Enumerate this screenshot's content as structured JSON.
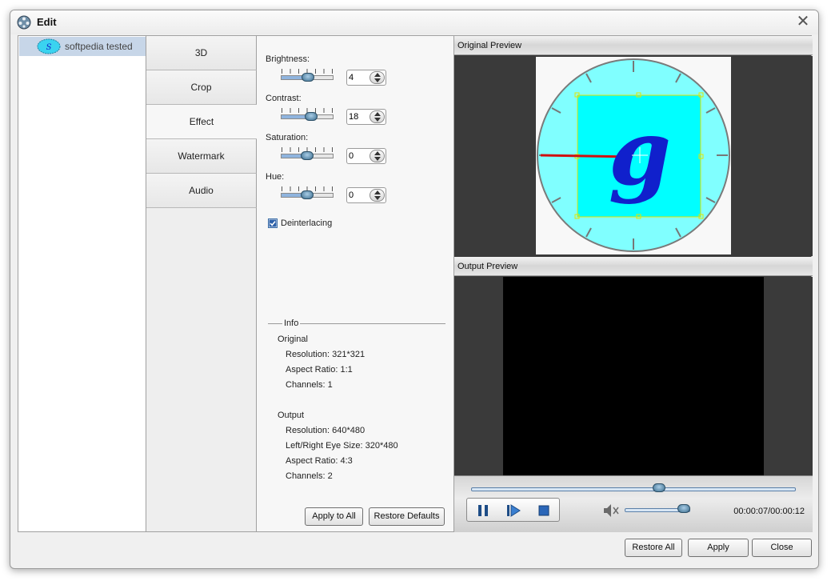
{
  "window": {
    "title": "Edit",
    "close_glyph": "✕"
  },
  "files": [
    {
      "label": "softpedia tested",
      "thumb_letter": "S"
    }
  ],
  "tabs": [
    {
      "label": "3D"
    },
    {
      "label": "Crop"
    },
    {
      "label": "Effect",
      "active": true
    },
    {
      "label": "Watermark"
    },
    {
      "label": "Audio"
    }
  ],
  "effect": {
    "brightness": {
      "label": "Brightness:",
      "value": "4",
      "fraction": 0.51
    },
    "contrast": {
      "label": "Contrast:",
      "value": "18",
      "fraction": 0.58
    },
    "saturation": {
      "label": "Saturation:",
      "value": "0",
      "fraction": 0.5
    },
    "hue": {
      "label": "Hue:",
      "value": "0",
      "fraction": 0.5
    },
    "deinterlacing": {
      "label": "Deinterlacing",
      "checked": true
    }
  },
  "info": {
    "title": "Info",
    "original": {
      "heading": "Original",
      "resolution": "Resolution: 321*321",
      "aspect": "Aspect Ratio: 1:1",
      "channels": "Channels: 1"
    },
    "output": {
      "heading": "Output",
      "resolution": "Resolution: 640*480",
      "eye_size": "Left/Right Eye Size: 320*480",
      "aspect": "Aspect Ratio: 4:3",
      "channels": "Channels: 2"
    }
  },
  "buttons": {
    "apply_all": "Apply to All",
    "restore_defaults": "Restore Defaults",
    "restore_all": "Restore All",
    "apply": "Apply",
    "close": "Close"
  },
  "preview": {
    "original_label": "Original Preview",
    "output_label": "Output Preview",
    "preview_letter": "g",
    "progress_fraction": 0.58,
    "volume_fraction": 0.9,
    "timecode": "00:00:07/00:00:12"
  },
  "colors": {
    "accent": "#8fb4de",
    "selection": "#c7d6e8",
    "crop_box": "#00ffff",
    "clock_face": "#80ffff",
    "letter": "#1020cc"
  },
  "icons": {
    "app": "film-reel-icon",
    "close": "close-icon",
    "pause": "pause-icon",
    "step": "step-forward-icon",
    "stop": "stop-icon",
    "volume": "speaker-icon"
  }
}
